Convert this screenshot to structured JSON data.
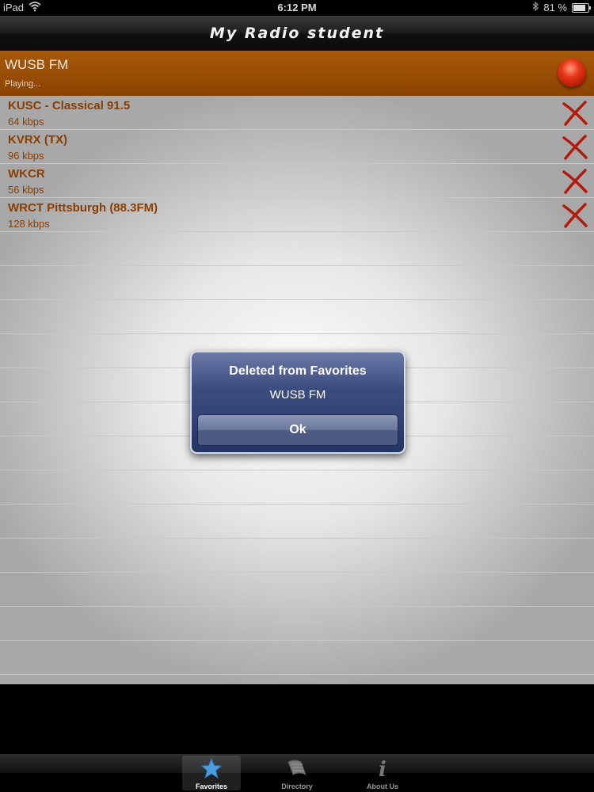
{
  "status_bar": {
    "carrier": "iPad",
    "time": "6:12 PM",
    "battery": "81 %",
    "battery_level": 0.81
  },
  "nav": {
    "title": "My Radio student"
  },
  "now_playing": {
    "station": "WUSB FM",
    "status": "Playing..."
  },
  "favorites": [
    {
      "name": "KUSC - Classical 91.5",
      "bitrate": "64 kbps"
    },
    {
      "name": "KVRX (TX)",
      "bitrate": "96 kbps"
    },
    {
      "name": "WKCR",
      "bitrate": "56 kbps"
    },
    {
      "name": "WRCT Pittsburgh (88.3FM)",
      "bitrate": "128 kbps"
    }
  ],
  "alert": {
    "title": "Deleted from Favorites",
    "message": "WUSB FM",
    "button": "Ok"
  },
  "tabs": [
    {
      "label": "Favorites",
      "icon": "star-icon",
      "active": true
    },
    {
      "label": "Directory",
      "icon": "book-icon",
      "active": false
    },
    {
      "label": "About Us",
      "icon": "info-icon",
      "active": false
    }
  ],
  "colors": {
    "accent": "#8a4300",
    "text_brown": "#8a3d00",
    "alert_blue": "#3c4d80"
  }
}
